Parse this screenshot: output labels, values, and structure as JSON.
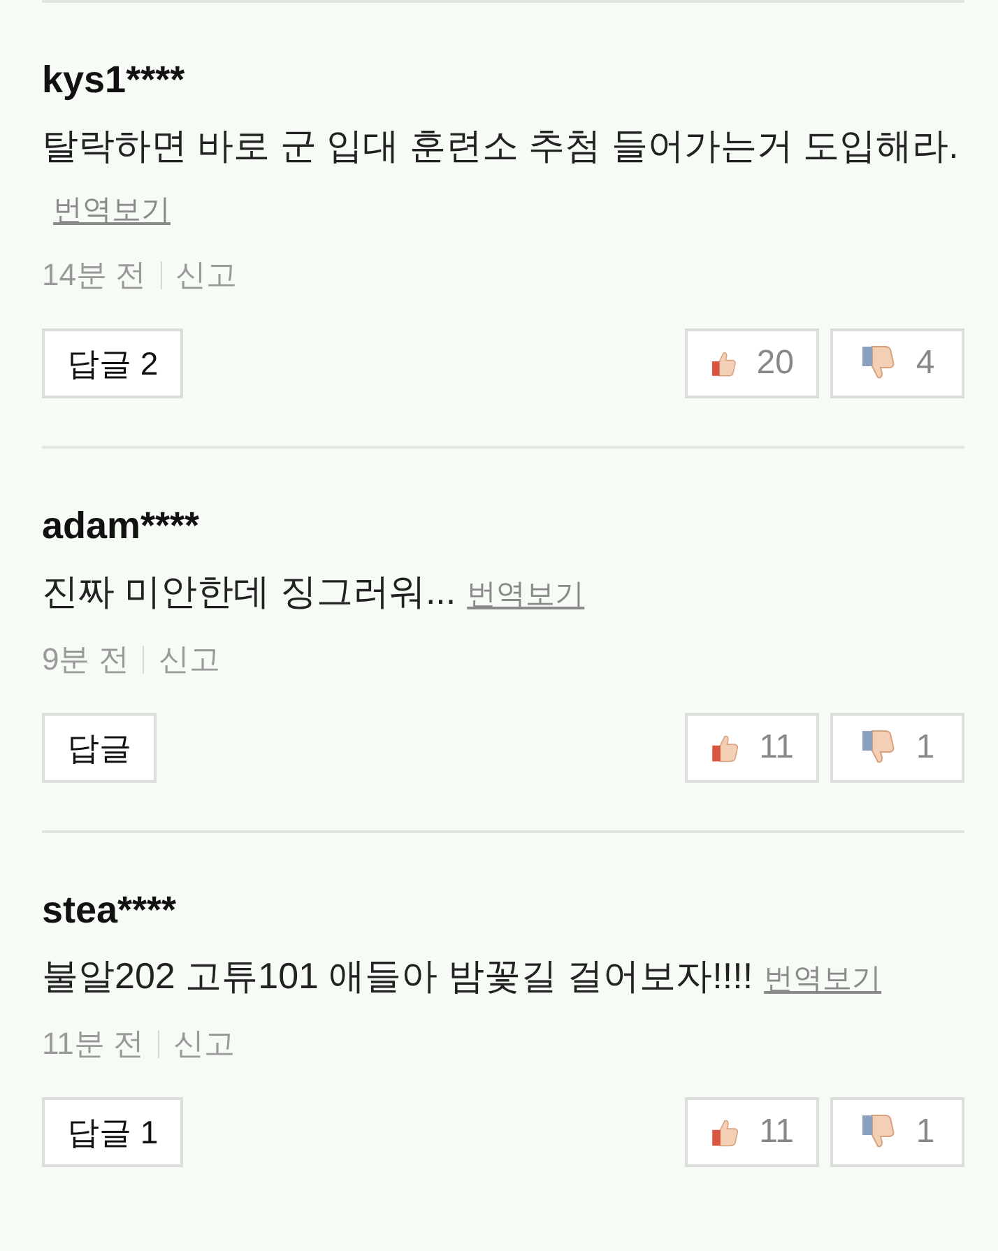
{
  "comments": [
    {
      "user": "kys1****",
      "text": "탈락하면 바로 군 입대 훈련소 추첨 들어가는거 도입해라.",
      "translate": "번역보기",
      "time": "14분 전",
      "report": "신고",
      "reply": "답글 2",
      "likes": "20",
      "dislikes": "4"
    },
    {
      "user": "adam****",
      "text": "진짜 미안한데 징그러워...",
      "translate": "번역보기",
      "time": "9분 전",
      "report": "신고",
      "reply": "답글",
      "likes": "11",
      "dislikes": "1"
    },
    {
      "user": "stea****",
      "text": "불알202 고튜101 애들아 밤꽃길 걸어보자!!!!",
      "translate": "번역보기",
      "time": "11분 전",
      "report": "신고",
      "reply": "답글 1",
      "likes": "11",
      "dislikes": "1"
    }
  ]
}
